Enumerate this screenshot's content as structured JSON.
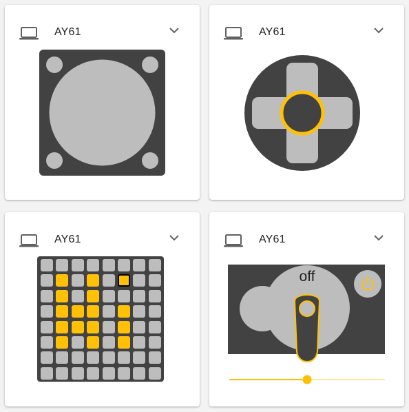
{
  "cards": [
    {
      "device_name": "AY61",
      "device_icon": "laptop-icon",
      "widget": "stick-pad"
    },
    {
      "device_name": "AY61",
      "device_icon": "laptop-icon",
      "widget": "dpad"
    },
    {
      "device_name": "AY61",
      "device_icon": "laptop-icon",
      "widget": "led-matrix",
      "matrix_rows": [
        "00000000",
        "01010000",
        "01010000",
        "01110100",
        "01110100",
        "01010100",
        "00000000",
        "00000000"
      ],
      "cursor_cell": {
        "row": 1,
        "col": 5
      }
    },
    {
      "device_name": "AY61",
      "device_icon": "laptop-icon",
      "widget": "toggle-stick",
      "state_label": "off",
      "slider_value": 0.5,
      "power_icon": "power-icon"
    }
  ],
  "colors": {
    "accent": "#ffc107",
    "dark": "#424242",
    "light": "#bdbdbd",
    "card": "#ffffff",
    "background": "#f3f3f3"
  }
}
